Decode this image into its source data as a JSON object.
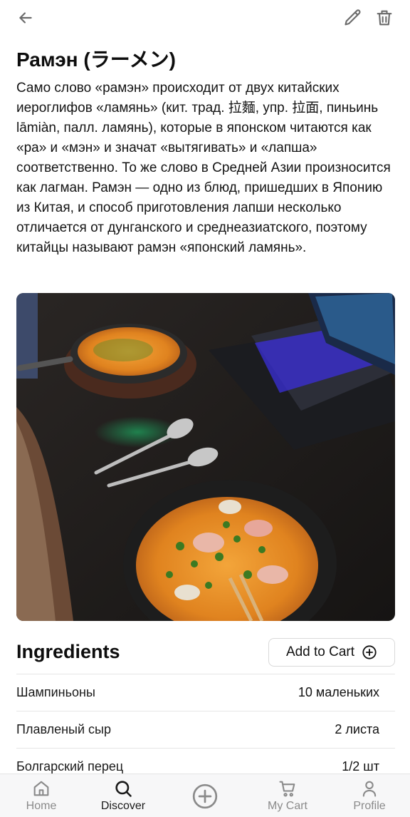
{
  "recipe": {
    "title": "Рамэн (ラーメン)",
    "description": "Само слово «рамэн» происходит от двух китайских иероглифов «ламянь» (кит. трад. 拉麵, упр. 拉面, пиньинь lāmiàn, палл. ламянь), которые в японском читаются как «ра» и «мэн» и значат «вытягивать» и «лапша» соответственно. То же слово в Средней Азии произносится как лагман. Рамэн — одно из блюд, пришедших в Японию из Китая, и способ приготовления лапши несколько отличается от дунганского и среднеазиатского, поэтому китайцы называют рамэн «японский ламянь»."
  },
  "ingredients": {
    "title": "Ingredients",
    "add_to_cart_label": "Add to Cart",
    "items": [
      {
        "name": "Шампиньоны",
        "quantity": "10 маленьких"
      },
      {
        "name": "Плавленый сыр",
        "quantity": "2 листа"
      },
      {
        "name": "Болгарский перец",
        "quantity": "1/2 шт"
      }
    ]
  },
  "nav": {
    "home": "Home",
    "discover": "Discover",
    "my_cart": "My Cart",
    "profile": "Profile"
  },
  "colors": {
    "active": "#1a1a1a",
    "inactive": "#8a8a8a",
    "divider": "#e6e6e6"
  }
}
